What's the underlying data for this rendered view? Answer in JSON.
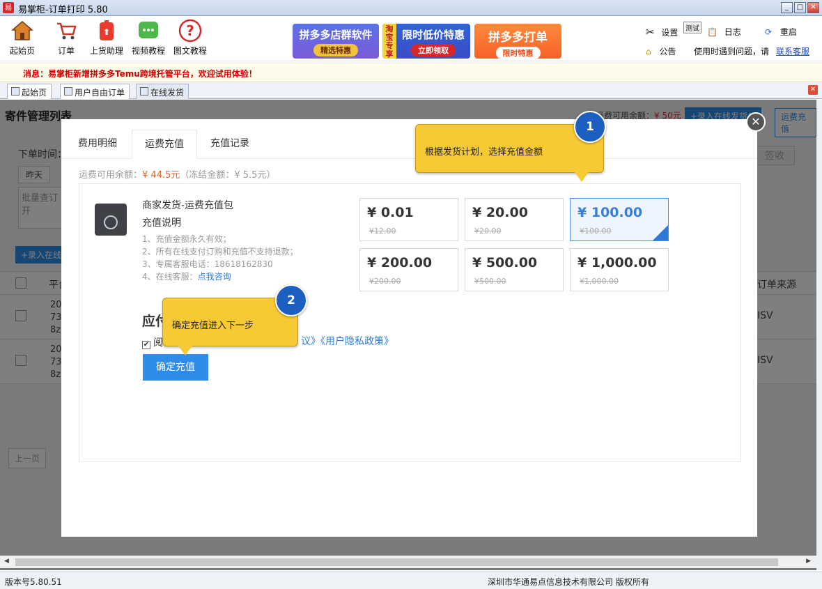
{
  "window": {
    "title": "易掌柜-订单打印 5.80",
    "app_icon_char": "易"
  },
  "toolbar": {
    "items": [
      {
        "label": "起始页",
        "icon": "home-icon"
      },
      {
        "label": "订单",
        "icon": "cart-icon"
      },
      {
        "label": "上货助理",
        "icon": "upload-bag-icon"
      },
      {
        "label": "视频教程",
        "icon": "chat-icon"
      },
      {
        "label": "图文教程",
        "icon": "help-icon"
      }
    ],
    "banners": [
      {
        "title": "拼多多店群软件",
        "sub": "精选特惠"
      },
      {
        "side": "淘宝专享",
        "title": "限时低价特惠",
        "sub": "立即领取"
      },
      {
        "title": "拼多多打单",
        "sub": "限时特惠"
      }
    ],
    "right": {
      "settings": "设置",
      "test_badge": "测试",
      "log": "日志",
      "restart": "重启",
      "notice": "公告",
      "help_text": "使用时遇到问题，请",
      "contact": "联系客服"
    }
  },
  "message": {
    "text": "消息：易掌柜新增拼多多Temu跨境托管平台，欢迎试用体验！"
  },
  "tabs": [
    {
      "label": "起始页"
    },
    {
      "label": "用户自由订单"
    },
    {
      "label": "在线发货"
    }
  ],
  "background": {
    "page_title": "寄件管理列表",
    "balance_label": "运费可用余额：",
    "balance_value": "¥ 50元",
    "record_btn": "+录入在线发货单",
    "recharge_btn": "运费充值",
    "order_time_label": "下单时间：",
    "yesterday": "昨天",
    "batch_query": "批量查订",
    "batch_query_2": "开",
    "record_btn2": "+录入在线",
    "col_platform": "平台",
    "col_source": "订单来源",
    "row1": [
      "20",
      "73",
      "8z"
    ],
    "row2": [
      "20",
      "73",
      "8z"
    ],
    "isv": "ISV",
    "prev": "上一页",
    "sign": "签收"
  },
  "modal": {
    "tabs": [
      "费用明细",
      "运费充值",
      "充值记录"
    ],
    "active_tab": 1,
    "balance_label": "运费可用余额：",
    "balance_value": "¥ 44.5元",
    "frozen": "（冻结金额：¥ 5.5元）",
    "package_title": "商家发货-运费充值包",
    "desc_title": "充值说明",
    "rules": [
      "1、充值金额永久有效；",
      "2、所有在线支付订购和充值不支持退款；",
      "3、专属客服电话：18618162830",
      "4、在线客服："
    ],
    "consult_link": "点我咨询",
    "amounts": [
      {
        "value": "¥ 0.01",
        "original": "¥12.00",
        "selected": false
      },
      {
        "value": "¥ 20.00",
        "original": "¥20.00",
        "selected": false
      },
      {
        "value": "¥ 100.00",
        "original": "¥100.00",
        "selected": true
      },
      {
        "value": "¥ 200.00",
        "original": "¥200.00",
        "selected": false
      },
      {
        "value": "¥ 500.00",
        "original": "¥500.00",
        "selected": false
      },
      {
        "value": "¥ 1,000.00",
        "original": "¥1,000.00",
        "selected": false
      }
    ],
    "pay_heading": "应付",
    "agree_text": "阅",
    "policy_link": "议》《用户隐私政策》",
    "confirm_btn": "确定充值"
  },
  "tips": [
    {
      "number": "1",
      "text": "根据发货计划，选择充值金额"
    },
    {
      "number": "2",
      "text": "确定充值进入下一步"
    }
  ],
  "status": {
    "version": "版本号5.80.51",
    "copyright": "深圳市华通易点信息技术有限公司 版权所有"
  },
  "colors": {
    "accent": "#2d8de8",
    "tip_yellow": "#f7c935",
    "badge_blue": "#1d5fc0",
    "price_red": "#f05a14"
  }
}
